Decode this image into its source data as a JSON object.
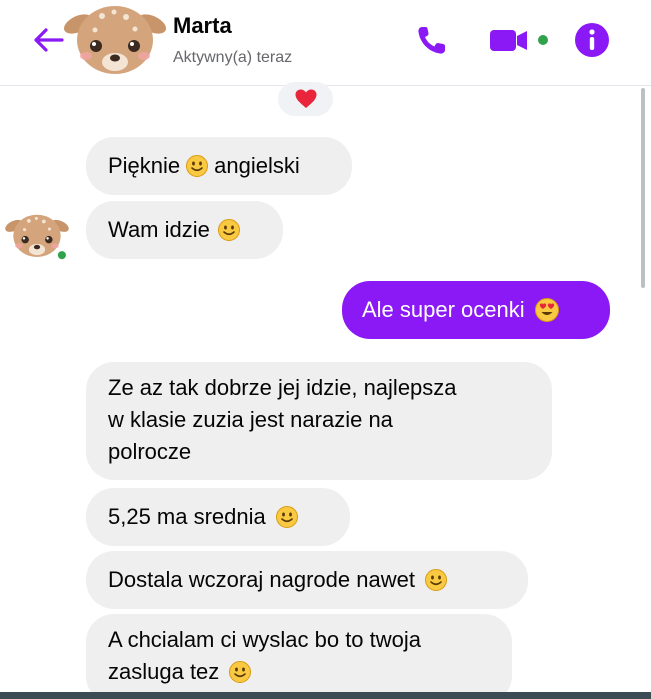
{
  "header": {
    "contact_name": "Marta",
    "status": "Aktywny(a) teraz"
  },
  "icons": {
    "back": "arrow-left-icon",
    "call": "phone-icon",
    "video": "video-camera-icon",
    "info": "info-icon",
    "reaction": "red-heart",
    "emoji_smile": "slightly-smiling-face",
    "emoji_heart_eyes": "smiling-face-with-heart-eyes"
  },
  "colors": {
    "accent": "#8a19f5",
    "received_bubble": "#efefef",
    "online_dot": "#31a24c",
    "heart": "#e8253a"
  },
  "messages": [
    {
      "side": "received",
      "parts": [
        "Pięknie",
        " angielski"
      ]
    },
    {
      "side": "received",
      "parts": [
        "Wam idzie"
      ]
    },
    {
      "side": "sent",
      "parts": [
        "Ale super ocenki"
      ]
    },
    {
      "side": "received",
      "lines": [
        "Ze az tak dobrze jej idzie, najlepsza",
        "w klasie zuzia jest narazie na",
        "polrocze"
      ]
    },
    {
      "side": "received",
      "parts": [
        "5,25 ma srednia"
      ]
    },
    {
      "side": "received",
      "parts": [
        "Dostala wczoraj nagrode nawet"
      ]
    },
    {
      "side": "received",
      "lines": [
        "A chcialam ci wyslac bo to twoja",
        "zasluga tez"
      ]
    }
  ]
}
